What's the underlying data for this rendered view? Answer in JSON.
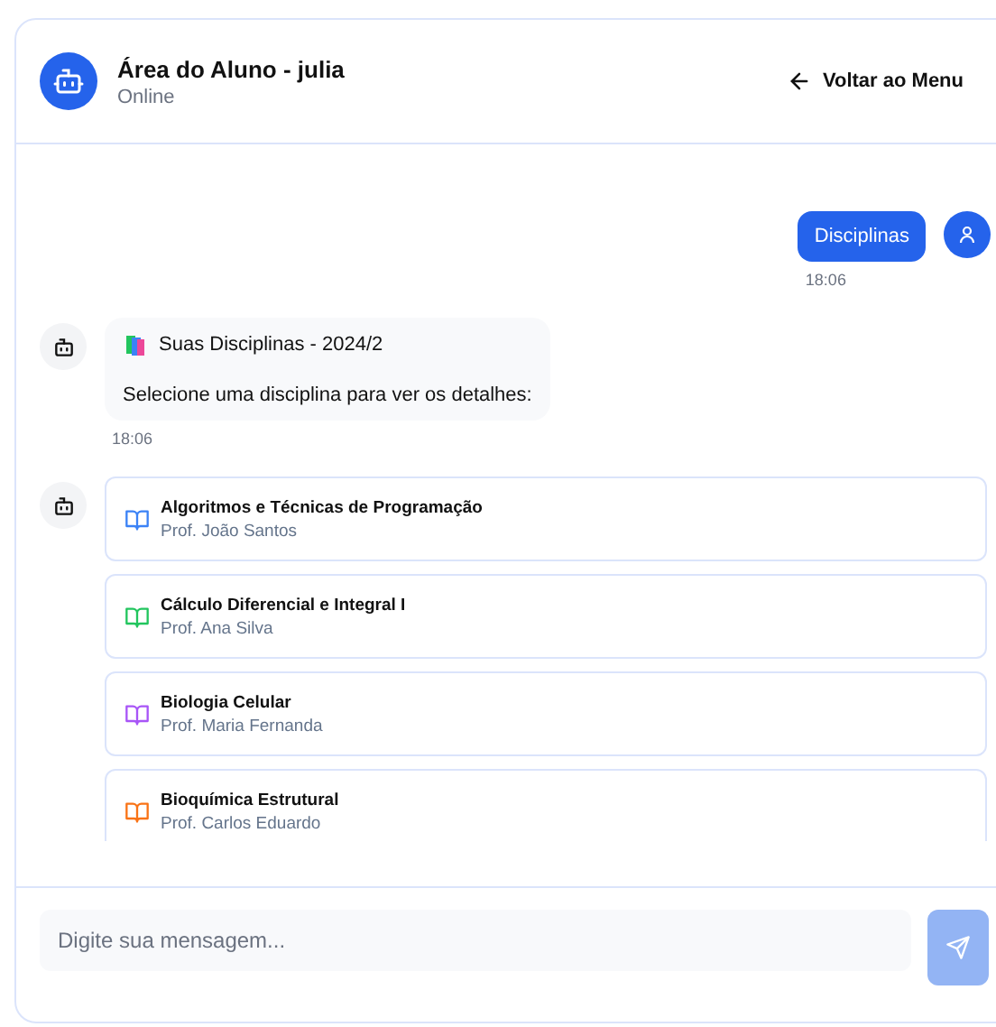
{
  "header": {
    "title": "Área do Aluno - julia",
    "status": "Online",
    "back_button": "Voltar ao Menu"
  },
  "messages": [
    {
      "kind": "user",
      "text": "Disciplinas",
      "time": "18:06"
    },
    {
      "kind": "bot",
      "title": "Suas Disciplinas - 2024/2",
      "text": "Selecione uma disciplina para ver os detalhes:",
      "time": "18:06"
    },
    {
      "kind": "courses",
      "courses": [
        {
          "name": "Algoritmos e Técnicas de Programação",
          "teacher": "Prof. João Santos",
          "color": "#3b82f6"
        },
        {
          "name": "Cálculo Diferencial e Integral I",
          "teacher": "Prof. Ana Silva",
          "color": "#22c55e"
        },
        {
          "name": "Biologia Celular",
          "teacher": "Prof. Maria Fernanda",
          "color": "#a855f7"
        },
        {
          "name": "Bioquímica Estrutural",
          "teacher": "Prof. Carlos Eduardo",
          "color": "#f97316"
        }
      ]
    }
  ],
  "composer": {
    "placeholder": "Digite sua mensagem...",
    "send_disabled": true
  }
}
